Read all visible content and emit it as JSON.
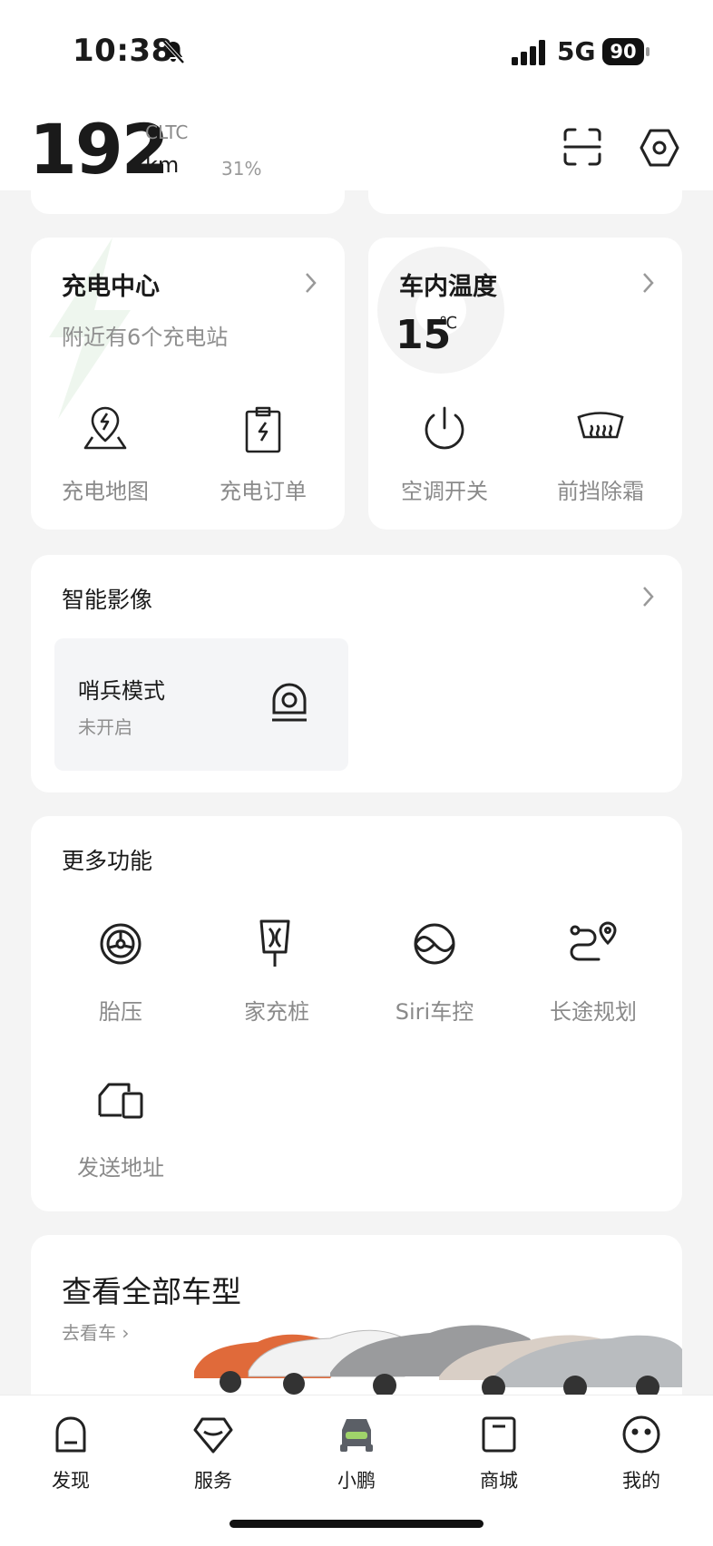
{
  "status": {
    "time": "10:38",
    "network": "5G",
    "battery": "90"
  },
  "header": {
    "range": "192",
    "range_std": "CLTC",
    "range_unit": "km",
    "battery_pct": "31%"
  },
  "charging": {
    "title": "充电中心",
    "subtitle": "附近有6个充电站",
    "actions": [
      {
        "label": "充电地图",
        "icon": "map-pin-bolt-icon"
      },
      {
        "label": "充电订单",
        "icon": "order-bolt-icon"
      }
    ]
  },
  "cabin": {
    "title": "车内温度",
    "temp": "15",
    "temp_unit": "℃",
    "actions": [
      {
        "label": "空调开关",
        "icon": "power-icon"
      },
      {
        "label": "前挡除霜",
        "icon": "defrost-icon"
      }
    ]
  },
  "video": {
    "title": "智能影像",
    "sentinel": {
      "title": "哨兵模式",
      "status": "未开启",
      "icon": "camera-icon"
    }
  },
  "more": {
    "title": "更多功能",
    "items": [
      {
        "label": "胎压",
        "icon": "tire-icon"
      },
      {
        "label": "家充桩",
        "icon": "charger-icon"
      },
      {
        "label": "Siri车控",
        "icon": "siri-icon"
      },
      {
        "label": "长途规划",
        "icon": "route-icon"
      },
      {
        "label": "发送地址",
        "icon": "send-address-icon"
      }
    ]
  },
  "models": {
    "title": "查看全部车型",
    "link": "去看车"
  },
  "tabs": [
    {
      "label": "发现",
      "icon": "discover-icon"
    },
    {
      "label": "服务",
      "icon": "service-icon"
    },
    {
      "label": "小鹏",
      "icon": "car-icon",
      "active": true
    },
    {
      "label": "商城",
      "icon": "mall-icon"
    },
    {
      "label": "我的",
      "icon": "profile-icon"
    }
  ],
  "colors": {
    "background": "#f4f4f4",
    "card": "#ffffff",
    "accent_car": "#5b5f66",
    "muted_text": "#8a8a8a"
  }
}
